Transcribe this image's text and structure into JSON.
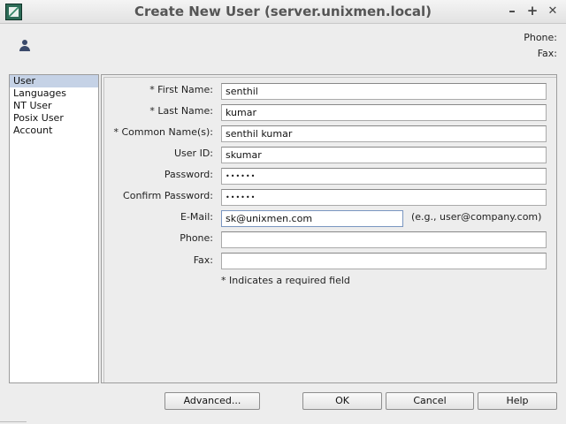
{
  "window": {
    "title": "Create New User (server.unixmen.local)",
    "controls": {
      "minimize": "–",
      "maximize": "+",
      "close": "✕"
    }
  },
  "header": {
    "phone_label": "Phone:",
    "fax_label": "Fax:"
  },
  "sidebar": {
    "items": [
      {
        "label": "User",
        "selected": true
      },
      {
        "label": "Languages",
        "selected": false
      },
      {
        "label": "NT User",
        "selected": false
      },
      {
        "label": "Posix User",
        "selected": false
      },
      {
        "label": "Account",
        "selected": false
      }
    ]
  },
  "form": {
    "first_name": {
      "label": "* First Name:",
      "value": "senthil"
    },
    "last_name": {
      "label": "* Last Name:",
      "value": "kumar"
    },
    "common_name": {
      "label": "* Common Name(s):",
      "value": "senthil kumar"
    },
    "user_id": {
      "label": "User ID:",
      "value": "skumar"
    },
    "password": {
      "label": "Password:",
      "value": "••••••"
    },
    "confirm_password": {
      "label": "Confirm Password:",
      "value": "••••••"
    },
    "email": {
      "label": "E-Mail:",
      "value": "sk@unixmen.com",
      "hint": "(e.g., user@company.com)"
    },
    "phone": {
      "label": "Phone:",
      "value": ""
    },
    "fax": {
      "label": "Fax:",
      "value": ""
    },
    "required_note": "* Indicates a required field"
  },
  "buttons": {
    "advanced": "Advanced...",
    "ok": "OK",
    "cancel": "Cancel",
    "help": "Help"
  },
  "icons": {
    "app": "app-window-icon",
    "user": "user-icon"
  }
}
